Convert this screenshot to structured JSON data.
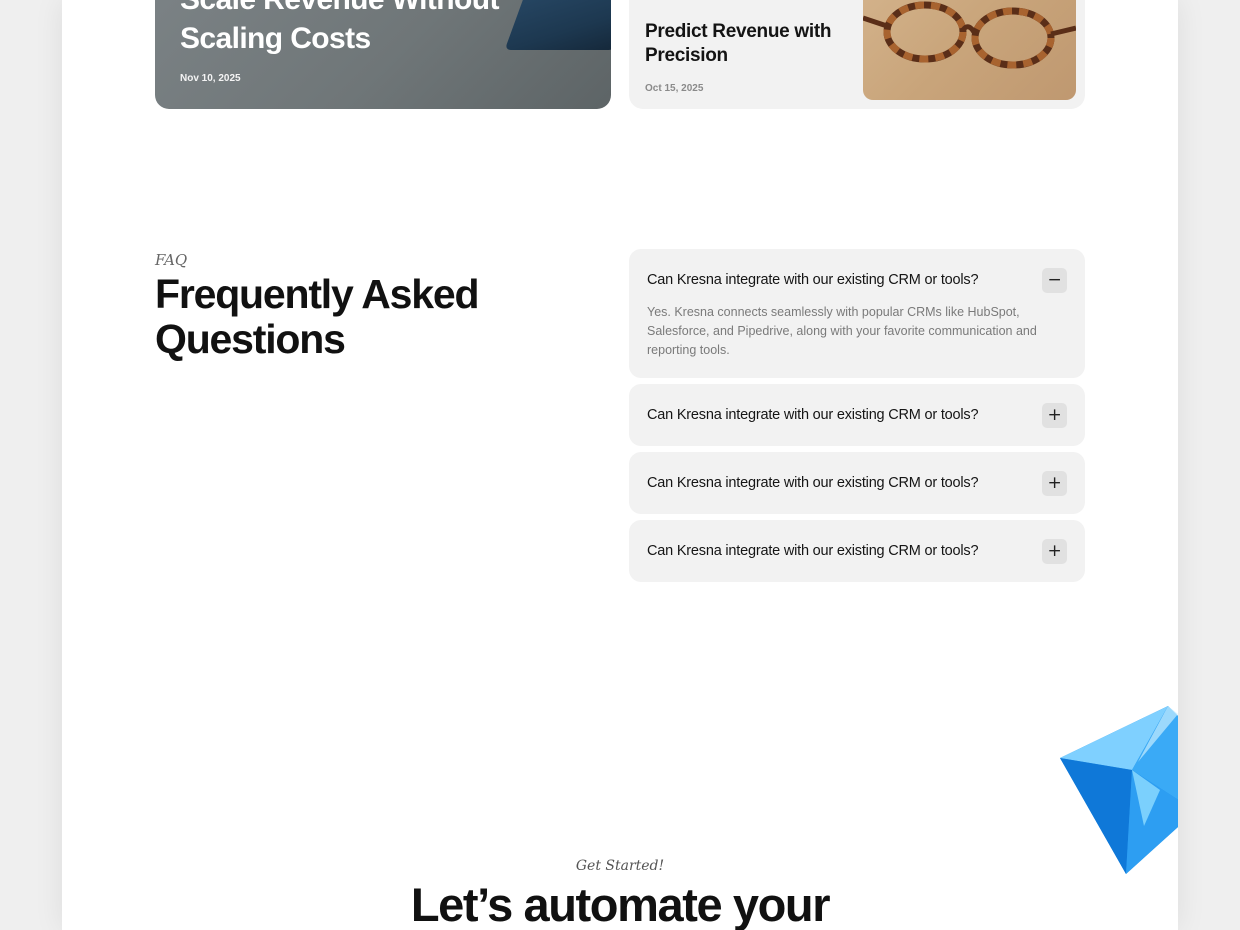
{
  "blog_cards": [
    {
      "title": "Scale Revenue Without Scaling Costs",
      "date": "Nov 10, 2025"
    },
    {
      "title": "Predict Revenue with Precision",
      "date": "Oct 15, 2025"
    }
  ],
  "faq": {
    "eyebrow": "FAQ",
    "heading": "Frequently Asked Questions",
    "items": [
      {
        "question": "Can Kresna integrate with our existing CRM or tools?",
        "answer": "Yes. Kresna connects seamlessly with popular CRMs like HubSpot, Salesforce, and Pipedrive, along with your favorite communication and reporting tools.",
        "toggle": "−",
        "open": true
      },
      {
        "question": "Can Kresna integrate with our existing CRM or tools?",
        "toggle": "+",
        "open": false
      },
      {
        "question": "Can Kresna integrate with our existing CRM or tools?",
        "toggle": "+",
        "open": false
      },
      {
        "question": "Can Kresna integrate with our existing CRM or tools?",
        "toggle": "+",
        "open": false
      }
    ]
  },
  "cta": {
    "eyebrow": "Get Started!",
    "heading": "Let’s automate your"
  },
  "colors": {
    "page_bg": "#efefef",
    "card_bg": "#f2f2f2",
    "gem_blue": "#1e9bf0"
  },
  "icons": {
    "collapse": "minus-icon",
    "expand": "plus-icon",
    "decoration": "gem-icon"
  }
}
